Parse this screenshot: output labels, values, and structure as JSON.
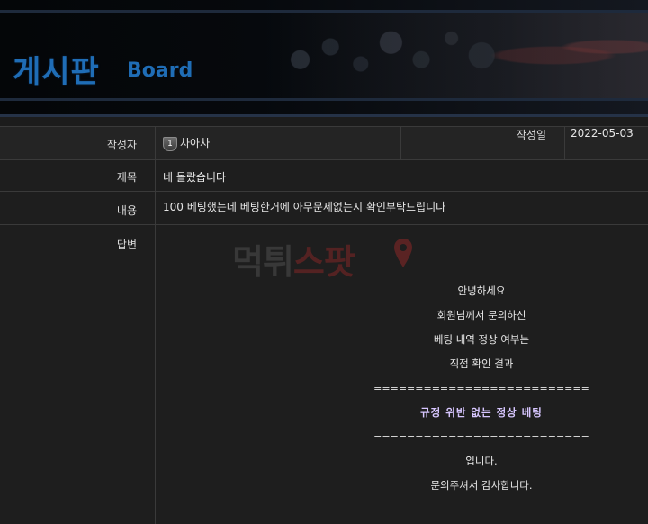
{
  "banner": {
    "title": "게시판",
    "subtitle": "Board"
  },
  "post": {
    "author_label": "작성자",
    "author_level": "1",
    "author_name": "차아차",
    "date_label": "작성일",
    "date": "2022-05-03",
    "subject_label": "제목",
    "subject": "네 몰랐습니다",
    "content_label": "내용",
    "content": "100 베팅했는데 베팅한거에 아무문제없는지 확인부탁드립니다",
    "reply_label": "답변"
  },
  "reply": {
    "watermark_part1": "먹튀",
    "watermark_part2": "스팟",
    "lines": [
      "안녕하세요",
      "회원님께서 문의하신",
      "베팅 내역 정상 여부는",
      "직접 확인 결과",
      "==========================",
      "규정 위반 없는 정상 베팅",
      "==========================",
      "입니다.",
      "문의주셔서 감사합니다."
    ]
  },
  "colors": {
    "banner_text": "#1f6db6",
    "highlight": "#d7c6ff",
    "watermark_red": "#962828"
  }
}
